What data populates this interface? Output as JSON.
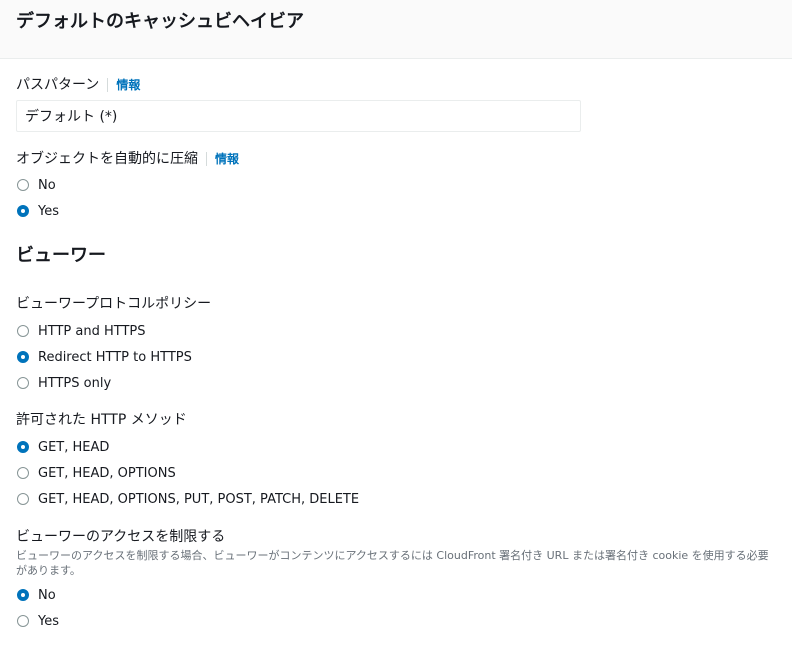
{
  "header": {
    "title": "デフォルトのキャッシュビヘイビア"
  },
  "path_pattern": {
    "label": "パスパターン",
    "info": "情報",
    "value": "デフォルト (*)"
  },
  "compress": {
    "label": "オブジェクトを自動的に圧縮",
    "info": "情報",
    "options": [
      {
        "label": "No",
        "selected": false
      },
      {
        "label": "Yes",
        "selected": true
      }
    ]
  },
  "viewer": {
    "title": "ビューワー",
    "protocol_policy": {
      "label": "ビューワープロトコルポリシー",
      "options": [
        {
          "label": "HTTP and HTTPS",
          "selected": false
        },
        {
          "label": "Redirect HTTP to HTTPS",
          "selected": true
        },
        {
          "label": "HTTPS only",
          "selected": false
        }
      ]
    },
    "allowed_methods": {
      "label": "許可された HTTP メソッド",
      "options": [
        {
          "label": "GET, HEAD",
          "selected": true
        },
        {
          "label": "GET, HEAD, OPTIONS",
          "selected": false
        },
        {
          "label": "GET, HEAD, OPTIONS, PUT, POST, PATCH, DELETE",
          "selected": false
        }
      ]
    },
    "restrict_access": {
      "label": "ビューワーのアクセスを制限する",
      "description": "ビューワーのアクセスを制限する場合、ビューワーがコンテンツにアクセスするには CloudFront 署名付き URL または署名付き cookie を使用する必要があります。",
      "options": [
        {
          "label": "No",
          "selected": true
        },
        {
          "label": "Yes",
          "selected": false
        }
      ]
    }
  }
}
